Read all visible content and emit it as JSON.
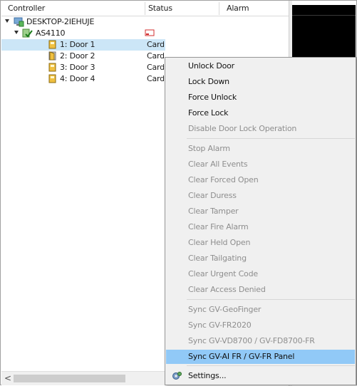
{
  "header": {
    "controller": "Controller",
    "status": "Status",
    "alarm": "Alarm"
  },
  "tree": {
    "pc": "DESKTOP-2IEHUJE",
    "controller": "AS4110",
    "doors": [
      {
        "label": "1: Door 1",
        "status": "Card Mode"
      },
      {
        "label": "2: Door 2",
        "status": "Card Mode"
      },
      {
        "label": "3: Door 3",
        "status": "Card Mode"
      },
      {
        "label": "4: Door 4",
        "status": "Card Mode"
      }
    ]
  },
  "menu": {
    "unlock_door": "Unlock Door",
    "lock_down": "Lock Down",
    "force_unlock": "Force Unlock",
    "force_lock": "Force Lock",
    "disable_lock_op": "Disable Door Lock Operation",
    "stop_alarm": "Stop Alarm",
    "clear_all_events": "Clear All Events",
    "clear_forced_open": "Clear Forced Open",
    "clear_duress": "Clear Duress",
    "clear_tamper": "Clear Tamper",
    "clear_fire_alarm": "Clear Fire Alarm",
    "clear_held_open": "Clear Held Open",
    "clear_tailgating": "Clear Tailgating",
    "clear_urgent_code": "Clear Urgent Code",
    "clear_access_denied": "Clear Access Denied",
    "sync_geofinger": "Sync GV-GeoFinger",
    "sync_fr2020": "Sync GV-FR2020",
    "sync_vd8700": "Sync GV-VD8700 / GV-FD8700-FR",
    "sync_ai_fr": "Sync GV-AI FR / GV-FR Panel",
    "settings": "Settings..."
  },
  "scrollbar": {
    "left_arrow": "<"
  },
  "colors": {
    "selection": "#cce6f7",
    "menu_highlight": "#91c9f7",
    "disabled_text": "#8e8e8e"
  }
}
